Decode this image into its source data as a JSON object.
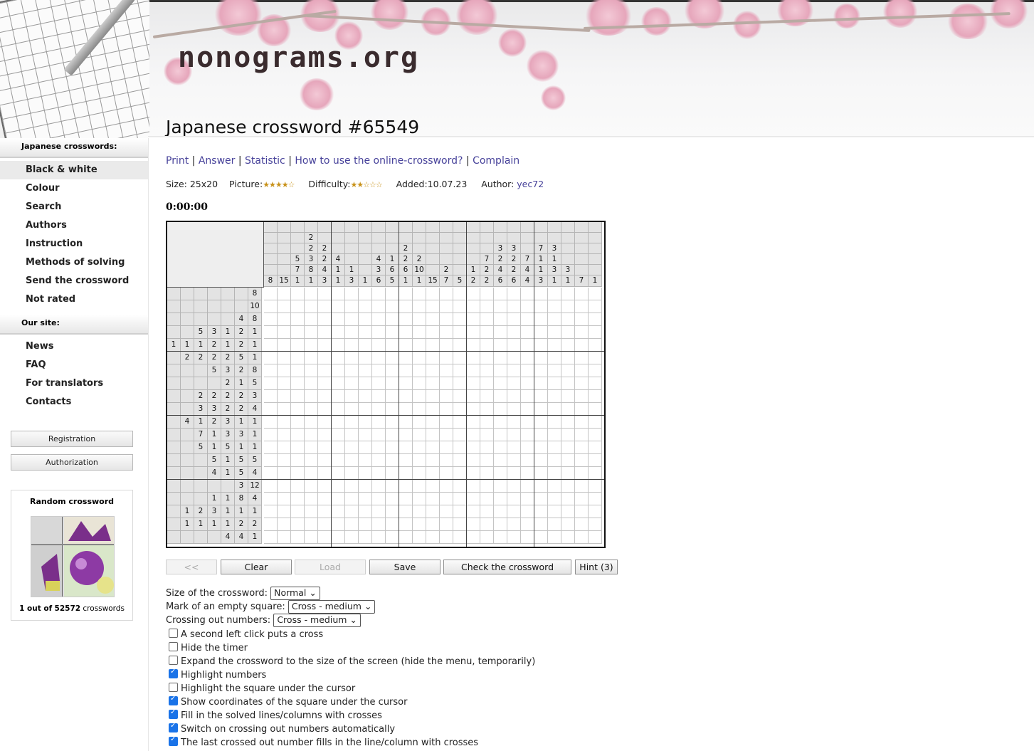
{
  "site": {
    "logo": "nonograms.org"
  },
  "page": {
    "title": "Japanese crossword #65549"
  },
  "sidebar": {
    "section1": "Japanese crosswords:",
    "items1": [
      "Black & white",
      "Colour",
      "Search",
      "Authors",
      "Instruction",
      "Methods of solving",
      "Send the crossword",
      "Not rated"
    ],
    "section2": "Our site:",
    "items2": [
      "News",
      "FAQ",
      "For translators",
      "Contacts"
    ],
    "registration": "Registration",
    "authorization": "Authorization",
    "random_title": "Random crossword",
    "random_count_pre": "1 out of",
    "random_count_num": "52572",
    "random_count_post": "crosswords"
  },
  "links": {
    "print": "Print",
    "answer": "Answer",
    "statistic": "Statistic",
    "howto": "How to use the online-crossword?",
    "complain": "Complain",
    "sep": "|"
  },
  "meta": {
    "size_label": "Size:",
    "size": "25x20",
    "picture_label": "Picture:",
    "picture_stars": "★★★★☆",
    "difficulty_label": "Difficulty:",
    "difficulty_stars": "★★☆☆☆",
    "added_label": "Added:",
    "added": "10.07.23",
    "author_label": "Author:",
    "author": "yec72"
  },
  "timer": "0:00:00",
  "puzzle": {
    "cols": 25,
    "rows": 20,
    "top_clues": [
      [
        "",
        "",
        "",
        "",
        "",
        "",
        "",
        "",
        "",
        "",
        "",
        "",
        "",
        "",
        "",
        "",
        "",
        "",
        "",
        "",
        "",
        "",
        "",
        "",
        ""
      ],
      [
        "",
        "",
        "",
        "2",
        "",
        "",
        "",
        "",
        "",
        "",
        "",
        "",
        "",
        "",
        "",
        "",
        "",
        "",
        "",
        "",
        "",
        "",
        "",
        "",
        ""
      ],
      [
        "",
        "",
        "",
        "2",
        "2",
        "",
        "",
        "",
        "",
        "",
        "2",
        "",
        "",
        "",
        "",
        "",
        "",
        "3",
        "3",
        "",
        "7",
        "3",
        "",
        "",
        ""
      ],
      [
        "",
        "",
        "5",
        "3",
        "2",
        "4",
        "",
        "",
        "4",
        "1",
        "2",
        "2",
        "",
        "",
        "",
        "",
        "7",
        "2",
        "2",
        "7",
        "1",
        "1",
        "",
        "",
        ""
      ],
      [
        "",
        "",
        "7",
        "8",
        "4",
        "1",
        "1",
        "",
        "3",
        "6",
        "6",
        "10",
        "",
        "2",
        "",
        "1",
        "2",
        "4",
        "2",
        "4",
        "1",
        "3",
        "3",
        "",
        ""
      ],
      [
        "8",
        "15",
        "1",
        "1",
        "3",
        "1",
        "3",
        "1",
        "6",
        "5",
        "1",
        "1",
        "15",
        "7",
        "5",
        "2",
        "2",
        "6",
        "6",
        "4",
        "3",
        "1",
        "1",
        "7",
        "1"
      ]
    ],
    "left_clues": [
      [
        "",
        "",
        "",
        "",
        "",
        "",
        "8"
      ],
      [
        "",
        "",
        "",
        "",
        "",
        "",
        "10"
      ],
      [
        "",
        "",
        "",
        "",
        "",
        "4",
        "8"
      ],
      [
        "",
        "",
        "5",
        "3",
        "1",
        "2",
        "1"
      ],
      [
        "1",
        "1",
        "1",
        "2",
        "1",
        "2",
        "1"
      ],
      [
        "",
        "2",
        "2",
        "2",
        "2",
        "5",
        "1"
      ],
      [
        "",
        "",
        "",
        "5",
        "3",
        "2",
        "8"
      ],
      [
        "",
        "",
        "",
        "",
        "2",
        "1",
        "5"
      ],
      [
        "",
        "",
        "2",
        "2",
        "2",
        "2",
        "3"
      ],
      [
        "",
        "",
        "3",
        "3",
        "2",
        "2",
        "4"
      ],
      [
        "",
        "4",
        "1",
        "2",
        "3",
        "1",
        "1"
      ],
      [
        "",
        "",
        "7",
        "1",
        "3",
        "3",
        "1"
      ],
      [
        "",
        "",
        "5",
        "1",
        "5",
        "1",
        "1"
      ],
      [
        "",
        "",
        "",
        "5",
        "1",
        "5",
        "5"
      ],
      [
        "",
        "",
        "",
        "4",
        "1",
        "5",
        "4"
      ],
      [
        "",
        "",
        "",
        "",
        "",
        "3",
        "12"
      ],
      [
        "",
        "",
        "",
        "1",
        "1",
        "8",
        "4"
      ],
      [
        "",
        "1",
        "2",
        "3",
        "1",
        "1",
        "1"
      ],
      [
        "",
        "1",
        "1",
        "1",
        "1",
        "2",
        "2"
      ],
      [
        "",
        "",
        "",
        "",
        "4",
        "4",
        "1"
      ]
    ]
  },
  "buttons": {
    "back": "<<",
    "clear": "Clear",
    "load": "Load",
    "save": "Save",
    "check": "Check the crossword",
    "hint": "Hint (3)"
  },
  "settings": {
    "size_label": "Size of the crossword:",
    "size_value": "Normal",
    "mark_label": "Mark of an empty square:",
    "mark_value": "Cross - medium",
    "crossing_label": "Crossing out numbers:",
    "crossing_value": "Cross - medium",
    "checkboxes": [
      {
        "label": "A second left click puts a cross",
        "checked": false
      },
      {
        "label": "Hide the timer",
        "checked": false
      },
      {
        "label": "Expand the crossword to the size of the screen (hide the menu, temporarily)",
        "checked": false
      },
      {
        "label": "Highlight numbers",
        "checked": true
      },
      {
        "label": "Highlight the square under the cursor",
        "checked": false
      },
      {
        "label": "Show coordinates of the square under the cursor",
        "checked": true
      },
      {
        "label": "Fill in the solved lines/columns with crosses",
        "checked": true
      },
      {
        "label": "Switch on crossing out numbers automatically",
        "checked": true
      },
      {
        "label": "The last crossed out number fills in the line/column with crosses",
        "checked": true
      }
    ]
  },
  "colors": {
    "link": "#47429a",
    "clue_bg": "#e3e3e3",
    "blossom": "#e6a6bb",
    "check": "#1a73e8"
  }
}
